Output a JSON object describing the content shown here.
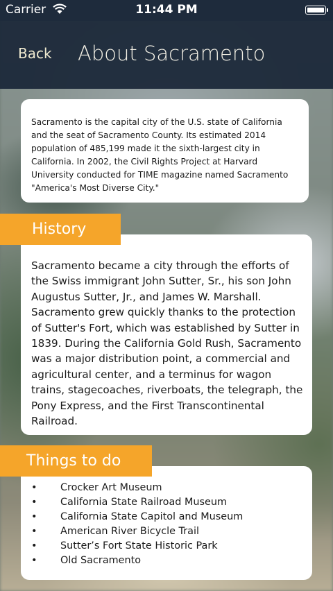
{
  "status_bar": {
    "carrier": "Carrier",
    "time": "11:44 PM",
    "battery_level": 1.0
  },
  "nav": {
    "back_label": "Back",
    "title": "About Sacramento"
  },
  "intro": {
    "text": "Sacramento is the capital city of the U.S. state of California and the seat of Sacramento County. Its estimated 2014 population of 485,199 made it the sixth-largest city in California. In 2002, the Civil Rights Project at Harvard University conducted for TIME magazine named Sacramento \"America's Most Diverse City.\""
  },
  "history": {
    "heading": "History",
    "text": "Sacramento became a city through the efforts of the Swiss immigrant John Sutter, Sr., his son John Augustus Sutter, Jr., and James W. Marshall. Sacramento grew quickly thanks to the protection of Sutter's Fort, which was established by Sutter in 1839. During the California Gold Rush, Sacramento was a major distribution point, a commercial and agricultural center, and a terminus for wagon trains, stagecoaches, riverboats, the telegraph, the Pony Express, and the First Transcontinental Railroad."
  },
  "things_to_do": {
    "heading": "Things to do",
    "bullet": "•",
    "items": [
      "Crocker Art Museum",
      "California State Railroad Museum",
      "California State Capitol and Museum",
      "American River Bicycle Trail",
      "Sutter’s Fort State Historic Park",
      "Old Sacramento"
    ]
  },
  "colors": {
    "nav_background": "#1a2738",
    "accent_orange": "#f5a52a",
    "back_text": "#f0ead0"
  },
  "icons": {
    "wifi": "wifi-icon",
    "battery": "battery-icon"
  }
}
